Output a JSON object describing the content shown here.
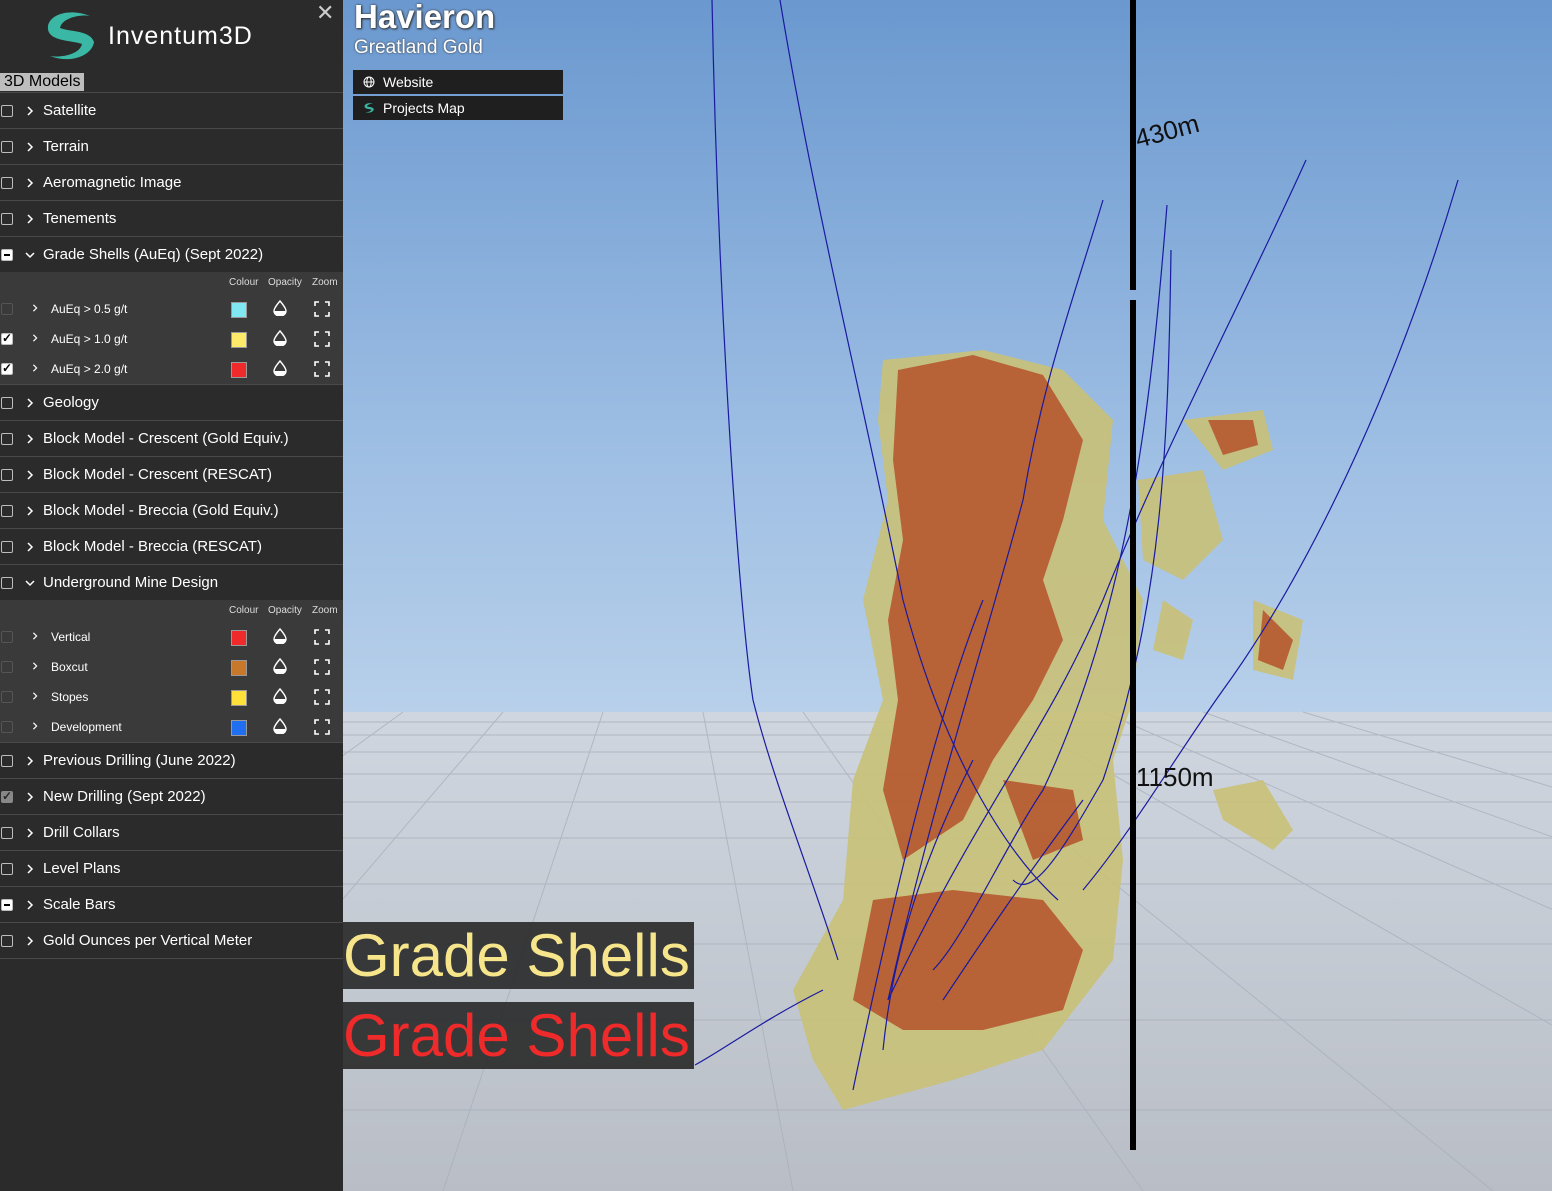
{
  "app": {
    "brand": "Inventum3D",
    "close_glyph": "✕",
    "section_tab": "3D Models"
  },
  "project": {
    "title": "Havieron",
    "subtitle": "Greatland Gold"
  },
  "links": [
    {
      "label": "Website",
      "icon": "globe-icon"
    },
    {
      "label": "Projects Map",
      "icon": "inventum-logo-icon"
    }
  ],
  "layers": [
    {
      "label": "Satellite",
      "state": "unchecked",
      "expanded": false
    },
    {
      "label": "Terrain",
      "state": "unchecked",
      "expanded": false
    },
    {
      "label": "Aeromagnetic Image",
      "state": "unchecked",
      "expanded": false
    },
    {
      "label": "Tenements",
      "state": "unchecked",
      "expanded": false
    },
    {
      "label": "Grade Shells (AuEq) (Sept 2022)",
      "state": "partial",
      "expanded": true,
      "children": [
        {
          "label": "AuEq > 0.5 g/t",
          "state": "unchecked",
          "colour": "#7fe8f0"
        },
        {
          "label": "AuEq > 1.0 g/t",
          "state": "checked",
          "colour": "#ffe96a"
        },
        {
          "label": "AuEq > 2.0 g/t",
          "state": "checked",
          "colour": "#f02a2a"
        }
      ]
    },
    {
      "label": "Geology",
      "state": "unchecked",
      "expanded": false
    },
    {
      "label": "Block Model - Crescent (Gold Equiv.)",
      "state": "unchecked",
      "expanded": false
    },
    {
      "label": "Block Model - Crescent (RESCAT)",
      "state": "unchecked",
      "expanded": false
    },
    {
      "label": "Block Model - Breccia (Gold Equiv.)",
      "state": "unchecked",
      "expanded": false
    },
    {
      "label": "Block Model - Breccia (RESCAT)",
      "state": "unchecked",
      "expanded": false
    },
    {
      "label": "Underground Mine Design",
      "state": "unchecked",
      "expanded": true,
      "children": [
        {
          "label": "Vertical",
          "state": "unchecked",
          "colour": "#f02a2a"
        },
        {
          "label": "Boxcut",
          "state": "unchecked",
          "colour": "#c7782a"
        },
        {
          "label": "Stopes",
          "state": "unchecked",
          "colour": "#ffe13a"
        },
        {
          "label": "Development",
          "state": "unchecked",
          "colour": "#1f6ff0"
        }
      ]
    },
    {
      "label": "Previous Drilling (June 2022)",
      "state": "unchecked",
      "expanded": false
    },
    {
      "label": "New Drilling (Sept 2022)",
      "state": "dim-checked",
      "expanded": false
    },
    {
      "label": "Drill Collars",
      "state": "unchecked",
      "expanded": false
    },
    {
      "label": "Level Plans",
      "state": "unchecked",
      "expanded": false
    },
    {
      "label": "Scale Bars",
      "state": "partial",
      "expanded": false
    },
    {
      "label": "Gold Ounces per Vertical Meter",
      "state": "unchecked",
      "expanded": false
    }
  ],
  "sub_headers": {
    "colour": "Colour",
    "opacity": "Opacity",
    "zoom": "Zoom"
  },
  "scale_labels": {
    "upper": "430m",
    "lower": "1150m"
  },
  "legend": [
    {
      "label": "Grade Shells",
      "colour": "#f6e58a"
    },
    {
      "label": "Grade Shells",
      "colour": "#ef2a2a"
    }
  ]
}
